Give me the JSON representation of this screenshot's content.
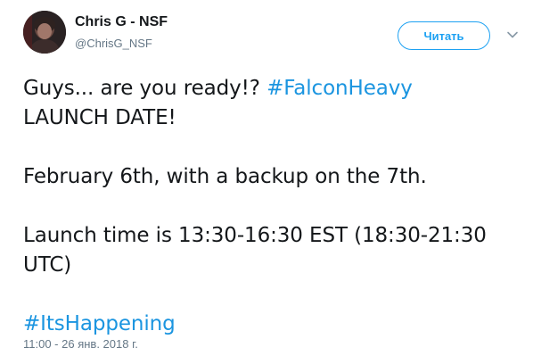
{
  "author": {
    "name": "Chris G - NSF",
    "handle": "@ChrisG_NSF"
  },
  "follow_button": {
    "label": "Читать"
  },
  "icons": {
    "avatar": "user-avatar",
    "caret": "chevron-down-icon"
  },
  "colors": {
    "link": "#1b95e0",
    "button_accent": "#1da1f2",
    "muted": "#657786",
    "text": "#14171a"
  },
  "tweet": {
    "line1_text": "Guys... are you ready!?  ",
    "line1_hashtag": "#FalconHeavy",
    "line2": "LAUNCH DATE!",
    "line3": "February 6th, with a backup on the 7th.",
    "line4": "Launch time is 13:30-16:30 EST (18:30-21:30",
    "line5": "UTC)",
    "hashtag2": "#ItsHappening"
  },
  "timestamp": "11:00 - 26 янв. 2018 г."
}
